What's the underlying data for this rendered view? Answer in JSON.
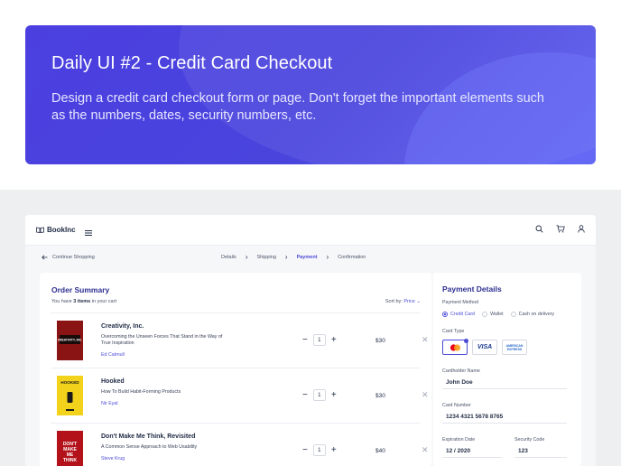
{
  "banner": {
    "title": "Daily UI  #2 - Credit Card Checkout",
    "description": "Design a credit card checkout form or page. Don't forget the important elements such as the numbers, dates, security numbers, etc."
  },
  "app": {
    "brand": "BookInc",
    "back_label": "Continue Shopping",
    "steps": [
      "Details",
      "Shipping",
      "Payment",
      "Confirmation"
    ],
    "active_step": "Payment"
  },
  "summary": {
    "title": "Order Summary",
    "count_prefix": "You have ",
    "count_value": "3 items",
    "count_suffix": " in your cart",
    "sort_label": "Sort by: ",
    "sort_value": "Price",
    "items": [
      {
        "title": "Creativity, Inc.",
        "subtitle": "Overcoming the Unseen Forces That Stand in the Way of True Inspiration",
        "author": "Ed Catmull",
        "qty": "1",
        "price": "$30",
        "cover_color": "#8a1414",
        "cover_text": "CREATIVITY, INC."
      },
      {
        "title": "Hooked",
        "subtitle": "How To Build Habit-Forming Products",
        "author": "Nir Eyal",
        "qty": "1",
        "price": "$30",
        "cover_color": "#f2d21a",
        "cover_text": "HOOKED"
      },
      {
        "title": "Don't Make Me Think, Revisited",
        "subtitle": "A Common Sense Approach to Web Usability",
        "author": "Steve Krug",
        "qty": "1",
        "price": "$40",
        "cover_color": "#b3121a",
        "cover_text": "DON'T MAKE ME THINK"
      }
    ]
  },
  "payment": {
    "title": "Payment Details",
    "method_label": "Payment Method",
    "methods": [
      "Credit Card",
      "Wallet",
      "Cash on delivery"
    ],
    "card_type_label": "Card Type",
    "card_types": [
      "mastercard",
      "VISA",
      "AMERICAN EXPRESS"
    ],
    "cardholder_label": "Cardholder Name",
    "cardholder_value": "John Doe",
    "card_number_label": "Card Number",
    "card_number_value": "1234  4321  5678  8765",
    "expiry_label": "Expiration Date",
    "expiry_value": "12  /  2020",
    "security_label": "Security Code",
    "security_value": "123"
  },
  "colors": {
    "accent": "#4b4bd8",
    "banner": "#4b3fe0"
  }
}
